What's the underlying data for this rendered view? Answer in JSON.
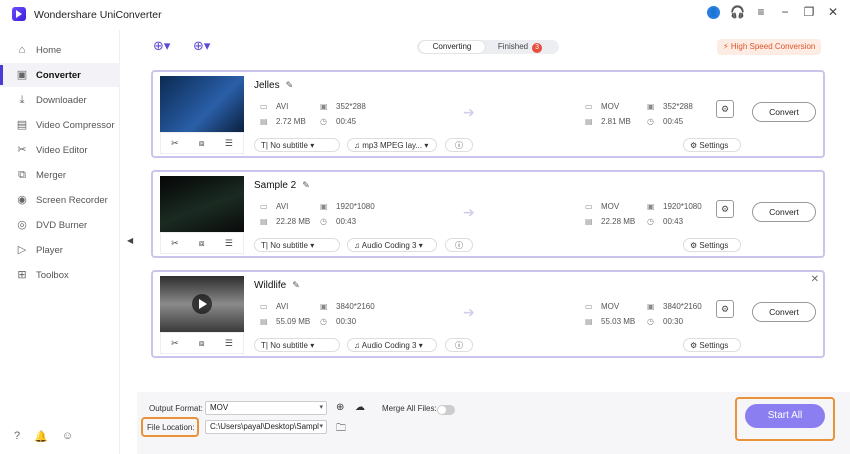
{
  "app": {
    "title": "Wondershare UniConverter"
  },
  "window_controls": [
    "user-icon",
    "headset-icon",
    "menu-icon",
    "minimize-icon",
    "maximize-icon",
    "close-icon"
  ],
  "sidebar": {
    "items": [
      {
        "label": "Home",
        "icon": "home-icon"
      },
      {
        "label": "Converter",
        "icon": "converter-icon",
        "active": true
      },
      {
        "label": "Downloader",
        "icon": "download-icon"
      },
      {
        "label": "Video Compressor",
        "icon": "compress-icon"
      },
      {
        "label": "Video Editor",
        "icon": "scissors-icon"
      },
      {
        "label": "Merger",
        "icon": "merge-icon"
      },
      {
        "label": "Screen Recorder",
        "icon": "record-icon"
      },
      {
        "label": "DVD Burner",
        "icon": "disc-icon"
      },
      {
        "label": "Player",
        "icon": "play-icon"
      },
      {
        "label": "Toolbox",
        "icon": "grid-icon"
      }
    ]
  },
  "tabs": {
    "converting": "Converting",
    "finished": "Finished",
    "finished_count": "3"
  },
  "high_speed": "High Speed Conversion",
  "files": [
    {
      "name": "Jelles",
      "src": {
        "format": "AVI",
        "res": "352*288",
        "size": "2.72 MB",
        "duration": "00:45"
      },
      "dst": {
        "format": "MOV",
        "res": "352*288",
        "size": "2.81 MB",
        "duration": "00:45"
      },
      "subtitle": "No subtitle",
      "audio": "mp3 MPEG lay...",
      "settings": "Settings",
      "convert": "Convert"
    },
    {
      "name": "Sample 2",
      "src": {
        "format": "AVI",
        "res": "1920*1080",
        "size": "22.28 MB",
        "duration": "00:43"
      },
      "dst": {
        "format": "MOV",
        "res": "1920*1080",
        "size": "22.28 MB",
        "duration": "00:43"
      },
      "subtitle": "No subtitle",
      "audio": "Audio Coding 3",
      "settings": "Settings",
      "convert": "Convert"
    },
    {
      "name": "Wildlife",
      "src": {
        "format": "AVI",
        "res": "3840*2160",
        "size": "55.09 MB",
        "duration": "00:30"
      },
      "dst": {
        "format": "MOV",
        "res": "3840*2160",
        "size": "55.03 MB",
        "duration": "00:30"
      },
      "subtitle": "No subtitle",
      "audio": "Audio Coding 3",
      "settings": "Settings",
      "convert": "Convert"
    }
  ],
  "bottom": {
    "output_format_label": "Output Format:",
    "output_format_value": "MOV",
    "merge_label": "Merge All Files:",
    "file_location_label": "File Location:",
    "file_location_value": "C:\\Users\\payal\\Desktop\\Sampl",
    "start_all": "Start All"
  },
  "colors": {
    "accent": "#4b3bd6",
    "start_all": "#8b7ef0",
    "highlight": "#e8923a",
    "card_border": "#c9c4e9"
  }
}
